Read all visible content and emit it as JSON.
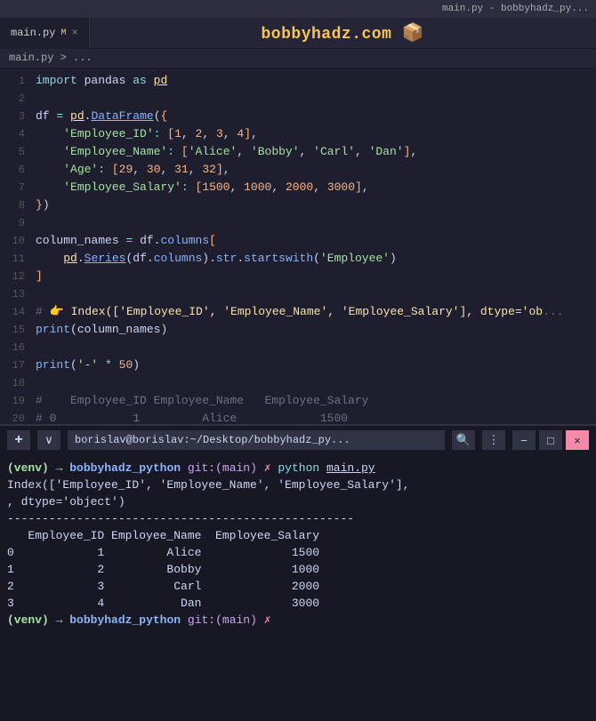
{
  "titlebar": {
    "text": "main.py - bobbyhadz_py..."
  },
  "tabs": {
    "file_tab": "main.py",
    "modified_marker": "M",
    "close_icon": "×",
    "site_title": "bobbyhadz.com",
    "site_icon": "📦"
  },
  "breadcrumb": {
    "text": "main.py > ..."
  },
  "code_lines": [
    {
      "num": "1",
      "content": ""
    },
    {
      "num": "2",
      "content": ""
    },
    {
      "num": "3",
      "content": ""
    },
    {
      "num": "4",
      "content": ""
    },
    {
      "num": "5",
      "content": ""
    },
    {
      "num": "6",
      "content": ""
    },
    {
      "num": "7",
      "content": ""
    },
    {
      "num": "8",
      "content": ""
    },
    {
      "num": "9",
      "content": ""
    },
    {
      "num": "10",
      "content": ""
    },
    {
      "num": "11",
      "content": ""
    },
    {
      "num": "12",
      "content": ""
    },
    {
      "num": "13",
      "content": ""
    },
    {
      "num": "14",
      "content": ""
    },
    {
      "num": "15",
      "content": ""
    },
    {
      "num": "16",
      "content": ""
    },
    {
      "num": "17",
      "content": ""
    },
    {
      "num": "18",
      "content": ""
    },
    {
      "num": "19",
      "content": ""
    },
    {
      "num": "20",
      "content": ""
    }
  ],
  "terminal": {
    "path": "borislav@borislav:~/Desktop/bobbyhadz_py...",
    "search_icon": "🔍",
    "menu_icon": "⋮",
    "minimize_icon": "−",
    "maximize_icon": "□",
    "close_icon": "×",
    "plus_icon": "+",
    "chevron_icon": "∨",
    "prompt_user": "(venv)",
    "arrow": "→",
    "dir": "bobbyhadz_python",
    "git_branch": "git:(main)",
    "cross": "✗",
    "cmd_python": "python",
    "cmd_file": "main.py",
    "output_line1": "Index(['Employee_ID', 'Employee_Name', 'Employee_Salary']",
    "output_line2": ", dtype='object')",
    "dash_line": "--------------------------------------------------",
    "table_header": "   Employee_ID Employee_Name  Employee_Salary",
    "rows": [
      {
        "idx": "0",
        "id": "1",
        "name": "Alice",
        "salary": "1500"
      },
      {
        "idx": "1",
        "id": "2",
        "name": "Bobby",
        "salary": "1000"
      },
      {
        "idx": "2",
        "id": "3",
        "name": "Carl",
        "salary": "2000"
      },
      {
        "idx": "3",
        "id": "4",
        "name": "Dan",
        "salary": "3000"
      }
    ],
    "prompt_end_user": "(venv)",
    "prompt_end_arrow": "→",
    "prompt_end_dir": "bobbyhadz_python",
    "prompt_end_git": "git:(main)",
    "prompt_end_cross": "✗"
  }
}
